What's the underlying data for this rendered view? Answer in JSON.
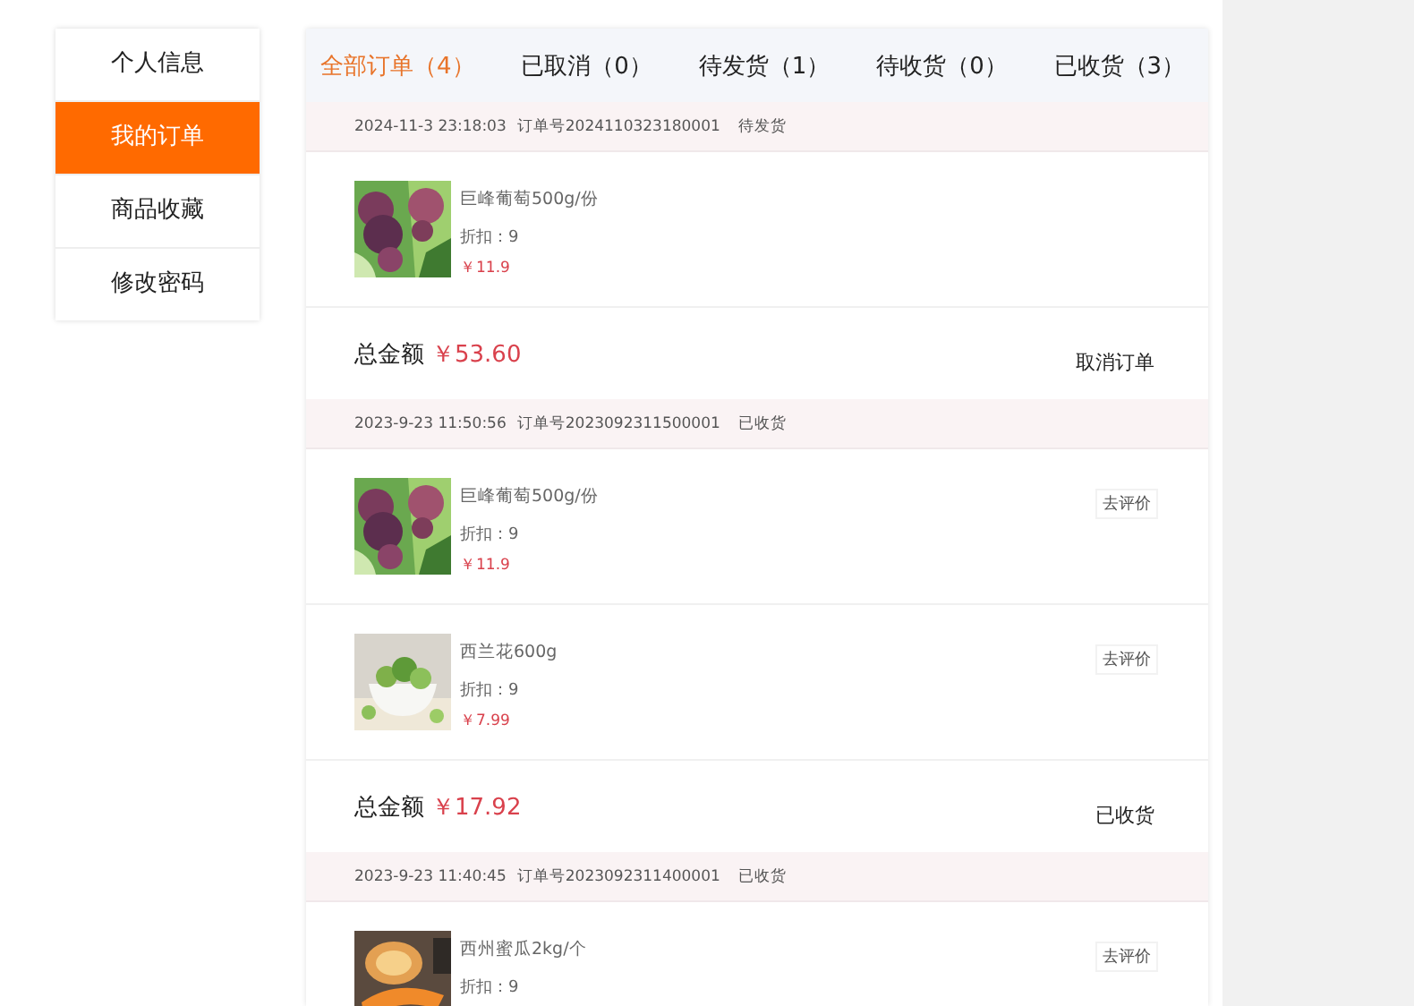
{
  "sidebar": {
    "items": [
      {
        "label": "个人信息",
        "selected": false
      },
      {
        "label": "我的订单",
        "selected": true
      },
      {
        "label": "商品收藏",
        "selected": false
      },
      {
        "label": "修改密码",
        "selected": false
      }
    ]
  },
  "tabs": [
    {
      "label": "全部订单（4）",
      "selected": true
    },
    {
      "label": "已取消（0）",
      "selected": false
    },
    {
      "label": "待发货（1）",
      "selected": false
    },
    {
      "label": "待收货（0）",
      "selected": false
    },
    {
      "label": "已收货（3）",
      "selected": false
    }
  ],
  "orders": [
    {
      "time": "2024-11-3 23:18:03",
      "order_no": "订单号2024110323180001",
      "status": "待发货",
      "items": [
        {
          "kind": "picture",
          "name": "巨峰葡萄500g/份",
          "discount": "折扣：9",
          "price": "￥11.9"
        }
      ],
      "total_label": "总金额",
      "total": "￥53.60",
      "action": "取消订单"
    },
    {
      "time": "2023-9-23 11:50:56",
      "order_no": "订单号2023092311500001",
      "status": "已收货",
      "items": [
        {
          "kind": "picture",
          "name": "巨峰葡萄500g/份",
          "discount": "折扣：9",
          "price": "￥11.9",
          "review": "去评价"
        },
        {
          "kind": "picture",
          "name": "西兰花600g",
          "discount": "折扣：9",
          "price": "￥7.99",
          "review": "去评价"
        }
      ],
      "total_label": "总金额",
      "total": "￥17.92",
      "action": "已收货"
    },
    {
      "time": "2023-9-23 11:40:45",
      "order_no": "订单号2023092311400001",
      "status": "已收货",
      "items": [
        {
          "kind": "picture",
          "name": "西州蜜瓜2kg/个",
          "discount": "折扣：9",
          "review": "去评价"
        }
      ]
    }
  ]
}
